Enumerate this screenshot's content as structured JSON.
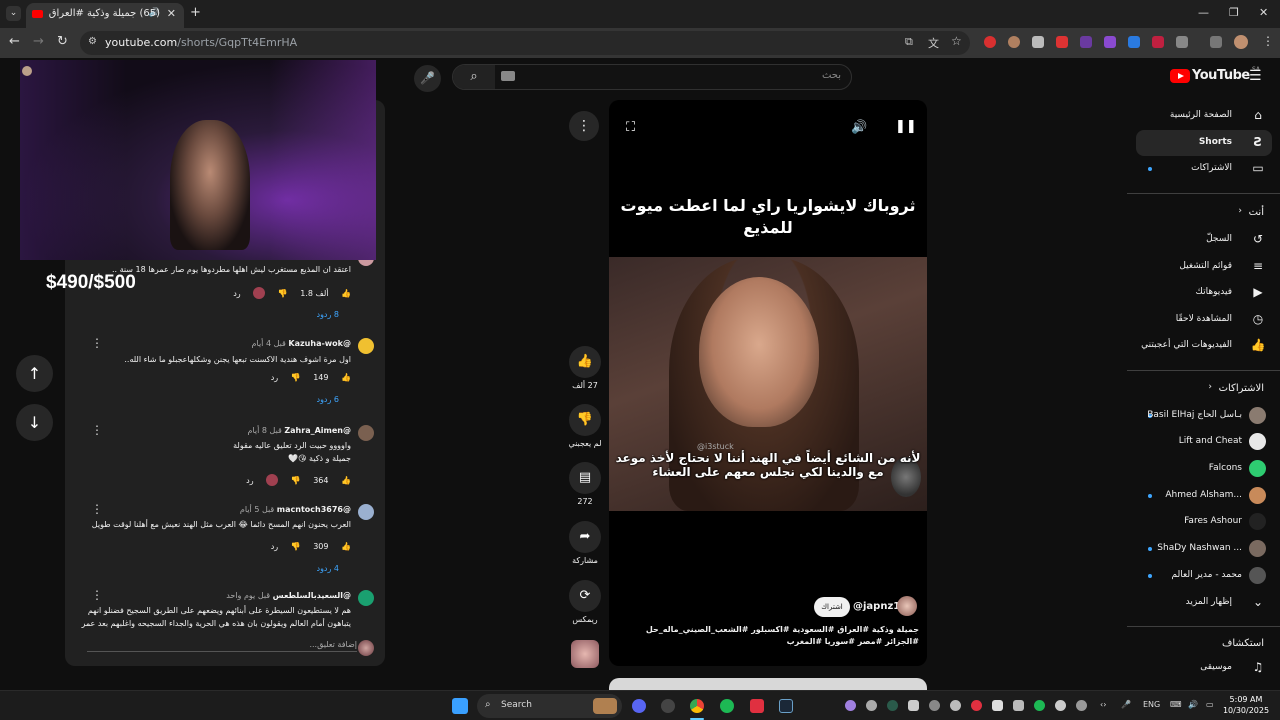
{
  "browser": {
    "tab_title": "(65) جميلة وذكية #العراق #ا...",
    "url_host": "youtube.com",
    "url_path": "/shorts/GqpTt4EmrHA"
  },
  "masthead": {
    "search_placeholder": "بحث",
    "logo_text": "YouTube",
    "country_code": "SA"
  },
  "sidebar": {
    "main": [
      {
        "label": "الصفحة الرئيسية",
        "icon": "home-icon",
        "glyph": "⌂"
      },
      {
        "label": "Shorts",
        "icon": "shorts-icon",
        "glyph": "S"
      },
      {
        "label": "الاشتراكات",
        "icon": "subscriptions-icon",
        "glyph": "▭"
      }
    ],
    "you_header": "أنت",
    "you": [
      {
        "label": "السجلّ",
        "icon": "history-icon",
        "glyph": "↺"
      },
      {
        "label": "قوائم التشغيل",
        "icon": "playlists-icon",
        "glyph": "≡"
      },
      {
        "label": "فيديوهاتك",
        "icon": "your-videos-icon",
        "glyph": "▶"
      },
      {
        "label": "المشاهدة لاحقًا",
        "icon": "watch-later-icon",
        "glyph": "◷"
      },
      {
        "label": "الفيديوهات التي أعجبتني",
        "icon": "liked-icon",
        "glyph": "👍"
      }
    ],
    "subs_header": "الاشتراكات",
    "subscriptions": [
      {
        "label": "Basil ElHaj بـاسل الحاج",
        "color": "#8a7b70"
      },
      {
        "label": "Lift and Cheat",
        "color": "#e8e8e8"
      },
      {
        "label": "Falcons",
        "color": "#2ecc71"
      },
      {
        "label": "Ahmed Alsham...",
        "color": "#c88a5a"
      },
      {
        "label": "Fares Ashour",
        "color": "#222222"
      },
      {
        "label": "ShaDy Nashwan ...",
        "color": "#7a6a60"
      },
      {
        "label": "محمد - مدير العالم",
        "color": "#555555"
      }
    ],
    "show_more": "إظهار المزيد",
    "explore_header": "استكشاف",
    "music": "موسيقى"
  },
  "short": {
    "caption_top": "ثروباك لايشواريا راي لما اعطت ميوت للمذيع",
    "caption_bottom": "لأنه من الشائع أيضاً في الهند أننا لا نحتاج لأخذ موعد مع والدينا لكي نجلس معهم على العشاء",
    "watermark": "@i3stuck",
    "channel": "@japnz1",
    "subscribe": "اشتراك",
    "tags": "جميلة وذكية #العراق #السعودية #اكسبلور #الشعب_الصيني_ماله_حل #الجزائر #مصر #سوريا #المغرب",
    "likes": "27 ألف",
    "dislike": "لم يعجبني",
    "comments": "272",
    "share": "مشاركة",
    "remix": "ريمكس"
  },
  "comments_panel": {
    "items": [
      {
        "user": "",
        "time": "",
        "text": "اعتقد ان المذيع مستغرب ليش اهلها مطردوها يوم صار عمرها 18 سنة ..",
        "likes": "1.8 ألف",
        "reply": "رد",
        "replies": "8 ردود",
        "avatar": "#cc9aa0"
      },
      {
        "user": "@Kazuha-wok",
        "time": "قبل 4 أيام",
        "text": "اول مرة اشوف هندية الاكسنت تبعها يجنن وشكلهاعجبلو ما شاء الله..",
        "likes": "149",
        "reply": "رد",
        "replies": "6 ردود",
        "avatar": "#f0c030"
      },
      {
        "user": "@Zahra_Aimen",
        "time": "قبل 8 أيام",
        "text": "واوووو حبيت الرد تعليق عاليه مقولة جميلة و ذكية 😘🤍",
        "likes": "364",
        "reply": "رد",
        "replies": "",
        "avatar": "#7a6050"
      },
      {
        "user": "@macntoch3676",
        "time": "قبل 5 أيام",
        "text": "العرب يحنون انهم المسح دائما 😂 العرب مثل الهند نعيش مع أهلنا لوقت طويل",
        "likes": "309",
        "reply": "رد",
        "replies": "4 ردود",
        "avatar": "#9ab0d0"
      },
      {
        "user": "@السعيدبالسلطعس",
        "time": "قبل يوم واحد",
        "text": "هم لا يستطيعون السيطرة على أبنائهم ويضعهم على الطريق السجيح فضنلو انهم يتباهون أمام العالم ويقولون بان هذه هي الحرية والجداء السجيحه واغلبهم بعد عمر السنين يلقون",
        "likes": "",
        "reply": "",
        "replies": "",
        "avatar": "#1aa070"
      }
    ],
    "add_comment": "إضافة تعليق..."
  },
  "overlay": {
    "donation_text": "$490/$500"
  },
  "taskbar": {
    "search": "Search",
    "lang": "ENG",
    "time": "5:09 AM",
    "date": "10/30/2025"
  }
}
